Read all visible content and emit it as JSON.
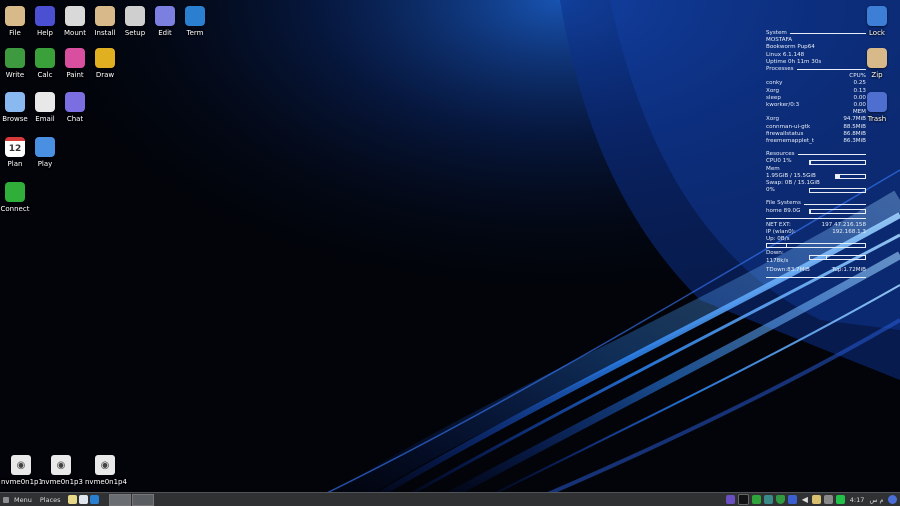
{
  "desktop": {
    "left_icons": [
      {
        "label": "File",
        "icon": "folder-home-icon",
        "color": "#d7b98a"
      },
      {
        "label": "Help",
        "icon": "help-icon",
        "color": "#4b4fd1"
      },
      {
        "label": "Mount",
        "icon": "drive-mount-icon",
        "color": "#d9d9d9"
      },
      {
        "label": "Install",
        "icon": "package-icon",
        "color": "#d7b98a"
      },
      {
        "label": "Setup",
        "icon": "setup-icon",
        "color": "#cfcfcf"
      },
      {
        "label": "Edit",
        "icon": "text-editor-icon",
        "color": "#7b7fe0"
      },
      {
        "label": "Term",
        "icon": "terminal-icon",
        "color": "#2a7fd0"
      },
      {
        "label": "Write",
        "icon": "document-write-icon",
        "color": "#3e9a3e"
      },
      {
        "label": "Calc",
        "icon": "spreadsheet-icon",
        "color": "#3aa13a"
      },
      {
        "label": "Paint",
        "icon": "paint-icon",
        "color": "#d94fa0"
      },
      {
        "label": "Draw",
        "icon": "draw-icon",
        "color": "#e0b020"
      },
      {
        "label": "Browse",
        "icon": "browser-cloud-icon",
        "color": "#8ab8f0"
      },
      {
        "label": "Email",
        "icon": "email-envelope-icon",
        "color": "#e8e8e8"
      },
      {
        "label": "Chat",
        "icon": "chat-bubble-icon",
        "color": "#7a6ee0"
      },
      {
        "label": "Plan",
        "icon": "calendar-icon",
        "color": "#ffffff"
      },
      {
        "label": "Play",
        "icon": "media-play-icon",
        "color": "#4a90e2"
      },
      {
        "label": "Connect",
        "icon": "connect-arrows-icon",
        "color": "#2fae3a"
      }
    ],
    "plan_day": "12",
    "right_icons": [
      {
        "label": "Lock",
        "icon": "lock-icon",
        "color": "#3d7fd6"
      },
      {
        "label": "Zip",
        "icon": "archive-icon",
        "color": "#d7b98a"
      },
      {
        "label": "Trash",
        "icon": "recycle-icon",
        "color": "#4e6fd0"
      }
    ],
    "drives": [
      {
        "label": "nvme0n1p1"
      },
      {
        "label": "nvme0n1p3"
      },
      {
        "label": "nvme0n1p4"
      }
    ]
  },
  "conky": {
    "system": {
      "title": "System",
      "hostname": "MOSTAFA",
      "distro": "Bookworm Pup64",
      "kernel": "Linux 6.1.148",
      "uptime": "Uptime 0h 11m 30s"
    },
    "processes": {
      "title": "Processes",
      "cpu_header": "CPU%",
      "cpu": [
        {
          "name": "conky",
          "value": "0.25"
        },
        {
          "name": "Xorg",
          "value": "0.13"
        },
        {
          "name": "sleep",
          "value": "0.00"
        },
        {
          "name": "kworker/0:3",
          "value": "0.00"
        }
      ],
      "mem_header": "MEM",
      "mem": [
        {
          "name": "Xorg",
          "value": "94.7MiB"
        },
        {
          "name": "connman-ui-gtk",
          "value": "88.5MiB"
        },
        {
          "name": "firewallstatus",
          "value": "86.8MiB"
        },
        {
          "name": "freememapplet_t",
          "value": "86.3MiB"
        }
      ]
    },
    "resources": {
      "title": "Resources",
      "cpu_label": "CPU0 1%",
      "cpu_fraction": 0.01,
      "mem_title": "Mem",
      "mem_label": "1.95GiB / 15.5GiB",
      "mem_fraction": 0.13,
      "swap_label": "Swap: 0B / 15.1GiB",
      "swap_percent": "0%",
      "swap_fraction": 0.0
    },
    "filesystems": {
      "title": "File Systems",
      "home_label": "home 89.0G",
      "home_fraction": 0.02
    },
    "network": {
      "ext_label": "NET EXT:",
      "ext_ip": "197.47.216.158",
      "lan_label": "IP (wlan0):",
      "lan_ip": "192.168.1.3",
      "up_label": "Up: 0B/s",
      "up_fraction": 0.2,
      "down_label": "Down: 1178k/s",
      "down_fraction": 0.3,
      "total_down": "TDown:83.7MiB",
      "total_up": "Tup:1.72MiB"
    }
  },
  "taskbar": {
    "menu_label": "Menu",
    "places_label": "Places",
    "clock": "4:17 م",
    "clock_suffix": "س"
  }
}
